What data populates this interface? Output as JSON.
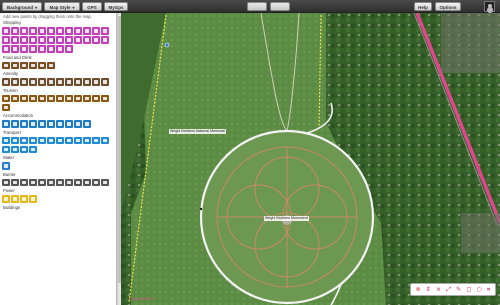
{
  "toolbar": {
    "background_label": "Background",
    "map_style_label": "Map Style",
    "gps_label": "GPS",
    "mygps_label": "MyGps",
    "disabled_a": "",
    "disabled_b": "",
    "help_label": "Help",
    "options_label": "Options"
  },
  "sidebar": {
    "hint": "Add new points by dragging them onto the map.",
    "categories": [
      {
        "key": "shopping",
        "label": "Shopping",
        "color": "#c43fb8",
        "count": 32
      },
      {
        "key": "food",
        "label": "Food and Drink",
        "color": "#7a4e21",
        "count": 6
      },
      {
        "key": "amenity",
        "label": "Amenity",
        "color": "#6d4c2f",
        "count": 12
      },
      {
        "key": "tourism",
        "label": "Tourism",
        "color": "#8a5a14",
        "count": 13
      },
      {
        "key": "accommodation",
        "label": "Accommodation",
        "color": "#1f7cc4",
        "count": 10
      },
      {
        "key": "transport",
        "label": "Transport",
        "color": "#1f8ad6",
        "count": 16
      },
      {
        "key": "water",
        "label": "Water",
        "color": "#2a7fd0",
        "count": 1
      },
      {
        "key": "barrier",
        "label": "Barrier",
        "color": "#555555",
        "count": 12
      },
      {
        "key": "power",
        "label": "Power",
        "color": "#e7b815",
        "count": 4
      },
      {
        "key": "buildings",
        "label": "Buildings",
        "color": "#8a8a8a",
        "count": 0
      }
    ]
  },
  "map": {
    "label_nature": "Wright Brothers National Memorial",
    "label_monument": "Wright Brothers Monument",
    "attribution": "Google Earth"
  },
  "map_tools": {
    "items": [
      "⊗",
      "⇕",
      "⨯",
      "⤢",
      "✎",
      "◻",
      "○",
      "⌗"
    ]
  }
}
